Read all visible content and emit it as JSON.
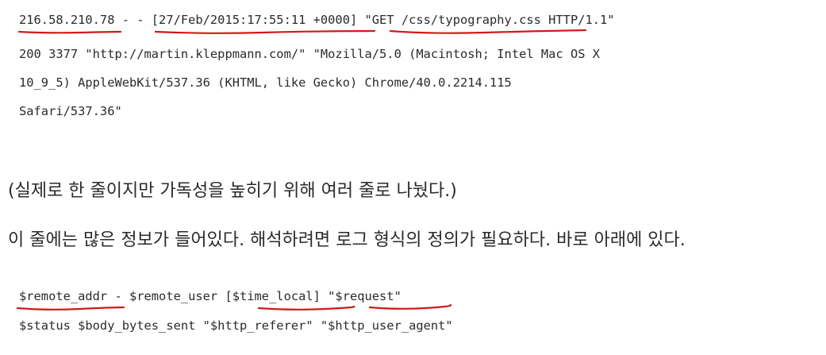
{
  "log_example": {
    "lines": [
      "216.58.210.78 - - [27/Feb/2015:17:55:11 +0000] \"GET /css/typography.css HTTP/1.1\"",
      "200 3377 \"http://martin.kleppmann.com/\" \"Mozilla/5.0 (Macintosh; Intel Mac OS X",
      "10_9_5) AppleWebKit/537.36 (KHTML, like Gecko) Chrome/40.0.2214.115",
      "Safari/537.36\""
    ]
  },
  "note": "(실제로 한 줄이지만 가독성을 높히기 위해 여러 줄로 나눴다.)",
  "explanation": "이 줄에는 많은 정보가 들어있다. 해석하려면 로그 형식의 정의가 필요하다. 바로 아래에 있다.",
  "log_format": {
    "lines": [
      "$remote_addr - $remote_user [$time_local] \"$request\"",
      "$status $body_bytes_sent \"$http_referer\" \"$http_user_agent\""
    ]
  },
  "annotation_color": "#d11a1a"
}
